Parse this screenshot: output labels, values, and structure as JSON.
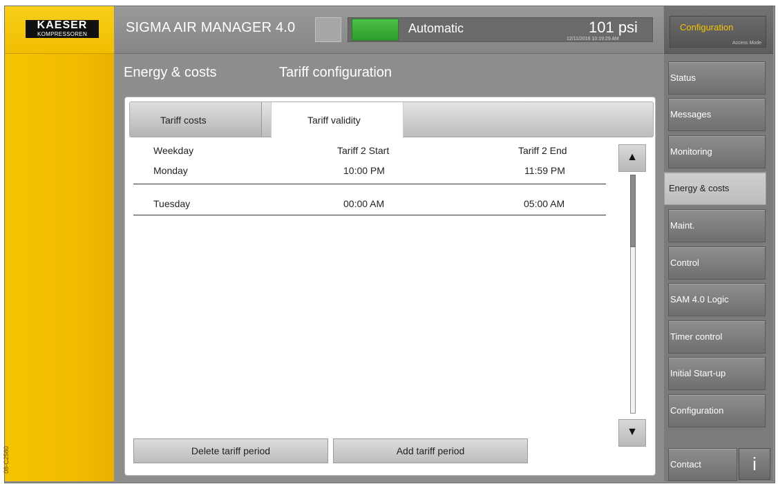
{
  "brand": {
    "name": "KAESER",
    "sub": "KOMPRESSOREN",
    "image_code": "08-C2580"
  },
  "header": {
    "app_title": "SIGMA AIR MANAGER 4.0",
    "mode": "Automatic",
    "pressure": "101 psi",
    "timestamp": "12/11/2016 10:19:29 AM",
    "status_color": "#3aaa35"
  },
  "right_panel": {
    "configuration_label": "Configuration",
    "access_mode_label": "Access Mode",
    "nav": [
      {
        "label": "Status"
      },
      {
        "label": "Messages"
      },
      {
        "label": "Monitoring"
      },
      {
        "label": "Energy & costs",
        "active": true
      },
      {
        "label": "Maint."
      },
      {
        "label": "Control"
      },
      {
        "label": "SAM 4.0 Logic"
      },
      {
        "label": "Timer control"
      },
      {
        "label": "Initial Start-up"
      },
      {
        "label": "Configuration"
      },
      {
        "label": "Contact"
      }
    ],
    "info_label": "i"
  },
  "breadcrumb": {
    "section": "Energy & costs",
    "page": "Tariff configuration"
  },
  "tabs": [
    {
      "label": "Tariff costs"
    },
    {
      "label": "Tariff validity",
      "active": true
    }
  ],
  "table": {
    "headers": [
      "Weekday",
      "Tariff 2 Start",
      "Tariff 2 End"
    ],
    "rows": [
      [
        "Monday",
        "10:00 PM",
        "11:59 PM"
      ],
      [
        "Tuesday",
        "00:00 AM",
        "05:00 AM"
      ]
    ]
  },
  "scroll": {
    "up_icon": "▲",
    "down_icon": "▼",
    "position_fraction": 0.0
  },
  "actions": {
    "delete_label": "Delete tariff period",
    "add_label": "Add tariff period"
  }
}
